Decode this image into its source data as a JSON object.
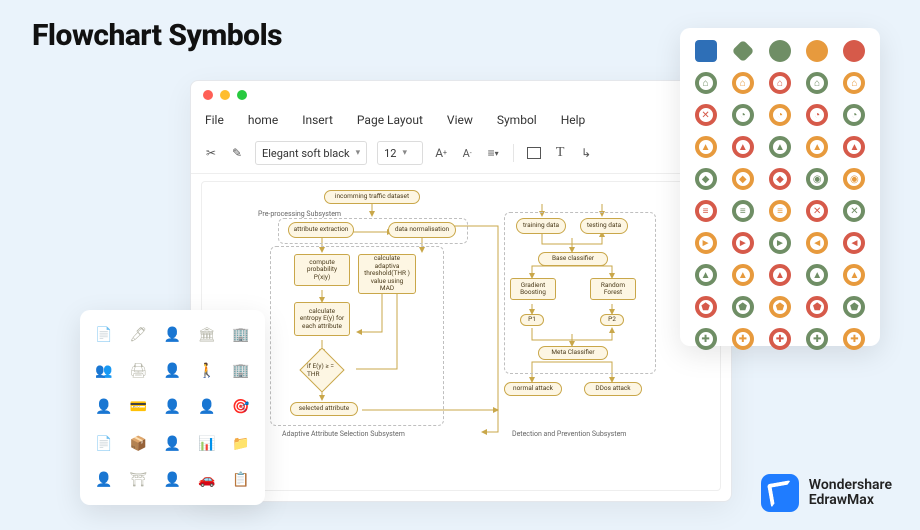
{
  "page_title": "Flowchart Symbols",
  "menus": [
    "File",
    "home",
    "Insert",
    "Page Layout",
    "View",
    "Symbol",
    "Help"
  ],
  "toolbar": {
    "font_select": "Elegant soft black",
    "size_select": "12"
  },
  "flow": {
    "top_term": "incomming traffic dataset",
    "preproc_label": "Pre-processing Subsystem",
    "attr_extract": "attribute extraction",
    "data_norm": "data normalisation",
    "compute_prob": "compute probability P(x|y)",
    "calc_thr": "calculate adaptiva threshold(THR ) value using MAD",
    "calc_entropy": "calculate entropy E(y) for each attribute",
    "decision": "if E(y) ≥ = THR",
    "selected_attr": "selected attribute",
    "left_caption": "Adaptive Attribute Selection Subsystem",
    "training": "training data",
    "testing": "testing data",
    "base_cls": "Base classifier",
    "gboost": "Gradient Boosting",
    "rforest": "Random Forest",
    "p1": "P1",
    "p2": "P2",
    "meta": "Meta Classifier",
    "normal": "normal attack",
    "ddos": "DDos attack",
    "right_caption": "Detection and Prevention Subsystem"
  },
  "colors": {
    "green": "#6f8e65",
    "orange": "#e79a3d",
    "red": "#d65a4a",
    "blue": "#2e6fb7"
  },
  "symbol_rows": [
    [
      {
        "k": "rect",
        "c": "blue"
      },
      {
        "k": "diamond",
        "c": "green"
      },
      {
        "k": "circle",
        "c": "green"
      },
      {
        "k": "circle",
        "c": "orange"
      },
      {
        "k": "circle",
        "c": "red"
      }
    ],
    [
      {
        "k": "ring",
        "c": "green",
        "g": "⌂"
      },
      {
        "k": "ring",
        "c": "orange",
        "g": "⌂"
      },
      {
        "k": "ring",
        "c": "red",
        "g": "⌂"
      },
      {
        "k": "ring",
        "c": "green",
        "g": "⌂"
      },
      {
        "k": "ring",
        "c": "orange",
        "g": "⌂"
      }
    ],
    [
      {
        "k": "ring",
        "c": "red",
        "g": "✕"
      },
      {
        "k": "ring",
        "c": "green",
        "g": "◔"
      },
      {
        "k": "ring",
        "c": "orange",
        "g": "◔"
      },
      {
        "k": "ring",
        "c": "red",
        "g": "◔"
      },
      {
        "k": "ring",
        "c": "green",
        "g": "◔"
      }
    ],
    [
      {
        "k": "ring",
        "c": "orange",
        "g": "▲"
      },
      {
        "k": "ring",
        "c": "red",
        "g": "▲"
      },
      {
        "k": "ring",
        "c": "green",
        "g": "▲"
      },
      {
        "k": "ring",
        "c": "orange",
        "g": "▲"
      },
      {
        "k": "ring",
        "c": "red",
        "g": "▲"
      }
    ],
    [
      {
        "k": "ring",
        "c": "green",
        "g": "◆"
      },
      {
        "k": "ring",
        "c": "orange",
        "g": "◆"
      },
      {
        "k": "ring",
        "c": "red",
        "g": "◆"
      },
      {
        "k": "ring",
        "c": "green",
        "g": "◉"
      },
      {
        "k": "ring",
        "c": "orange",
        "g": "◉"
      }
    ],
    [
      {
        "k": "ring",
        "c": "red",
        "g": "≡"
      },
      {
        "k": "ring",
        "c": "green",
        "g": "≡"
      },
      {
        "k": "ring",
        "c": "orange",
        "g": "≡"
      },
      {
        "k": "ring",
        "c": "red",
        "g": "✕"
      },
      {
        "k": "ring",
        "c": "green",
        "g": "✕"
      }
    ],
    [
      {
        "k": "ring",
        "c": "orange",
        "g": "►"
      },
      {
        "k": "ring",
        "c": "red",
        "g": "►"
      },
      {
        "k": "ring",
        "c": "green",
        "g": "►"
      },
      {
        "k": "ring",
        "c": "orange",
        "g": "◄"
      },
      {
        "k": "ring",
        "c": "red",
        "g": "◄"
      }
    ],
    [
      {
        "k": "ring",
        "c": "green",
        "g": "▲"
      },
      {
        "k": "ring",
        "c": "orange",
        "g": "▲"
      },
      {
        "k": "ring",
        "c": "red",
        "g": "▲"
      },
      {
        "k": "ring",
        "c": "green",
        "g": "▲"
      },
      {
        "k": "ring",
        "c": "orange",
        "g": "▲"
      }
    ],
    [
      {
        "k": "ring",
        "c": "red",
        "g": "⬟"
      },
      {
        "k": "ring",
        "c": "green",
        "g": "⬟"
      },
      {
        "k": "ring",
        "c": "orange",
        "g": "⬟"
      },
      {
        "k": "ring",
        "c": "red",
        "g": "⬟"
      },
      {
        "k": "ring",
        "c": "green",
        "g": "⬟"
      }
    ],
    [
      {
        "k": "ring",
        "c": "green",
        "g": "✚"
      },
      {
        "k": "ring",
        "c": "orange",
        "g": "✚"
      },
      {
        "k": "ring",
        "c": "red",
        "g": "✚"
      },
      {
        "k": "ring",
        "c": "green",
        "g": "✚"
      },
      {
        "k": "ring",
        "c": "orange",
        "g": "✚"
      }
    ]
  ],
  "cliparts": [
    "📄",
    "🖊",
    "👤",
    "🏛",
    "🏢",
    "👥",
    "🖨",
    "👤",
    "🚶",
    "🏢",
    "👤",
    "💳",
    "👤",
    "👤",
    "🎯",
    "📄",
    "📦",
    "👤",
    "📊",
    "📁",
    "👤",
    "⛩",
    "👤",
    "🚗",
    "📋"
  ],
  "brand": {
    "line1": "Wondershare",
    "line2": "EdrawMax"
  }
}
